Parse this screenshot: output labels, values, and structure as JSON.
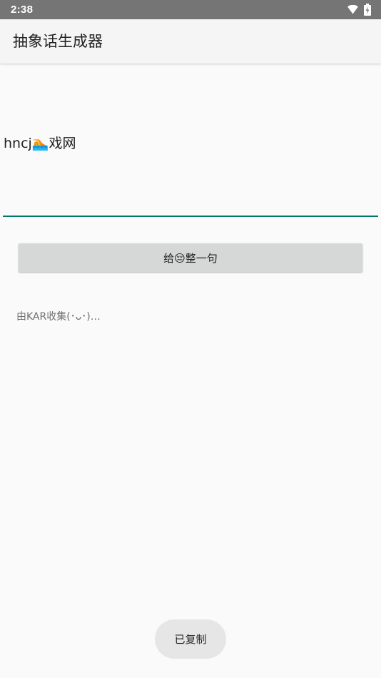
{
  "status_bar": {
    "time": "2:38",
    "icons": [
      "wifi-icon",
      "battery-charging-icon"
    ]
  },
  "app_bar": {
    "title": "抽象话生成器"
  },
  "input": {
    "value": "hncj🏊戏网"
  },
  "generate_button": {
    "label": "给😔整一句"
  },
  "credit": {
    "text": "由KAR收集(･ᴗ･)…"
  },
  "toast": {
    "text": "已复制"
  },
  "colors": {
    "status_bar_bg": "#757575",
    "app_bar_bg": "#f5f5f5",
    "accent": "#00796b",
    "button_bg": "#d6d7d7",
    "page_bg": "#fafafa"
  }
}
